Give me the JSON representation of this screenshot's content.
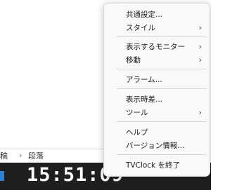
{
  "document": {
    "left_text": "稿",
    "separator": "›",
    "right_text": "段落"
  },
  "taskbar": {
    "clock_time": "15:51:09",
    "app_icon": "app-taskbar-icon",
    "background_color": "#1f1f1f"
  },
  "menu": {
    "items": [
      {
        "label": "共通設定...",
        "submenu": false
      },
      {
        "label": "スタイル",
        "submenu": true
      },
      {
        "label": "表示するモニター",
        "submenu": true
      },
      {
        "label": "移動",
        "submenu": true
      },
      {
        "label": "アラーム...",
        "submenu": false
      },
      {
        "label": "表示時差...",
        "submenu": false
      },
      {
        "label": "ツール",
        "submenu": true
      },
      {
        "label": "ヘルプ",
        "submenu": false
      },
      {
        "label": "バージョン情報...",
        "submenu": false
      },
      {
        "label": "TVClock を終了",
        "submenu": false
      }
    ],
    "chevron_glyph": "›"
  }
}
